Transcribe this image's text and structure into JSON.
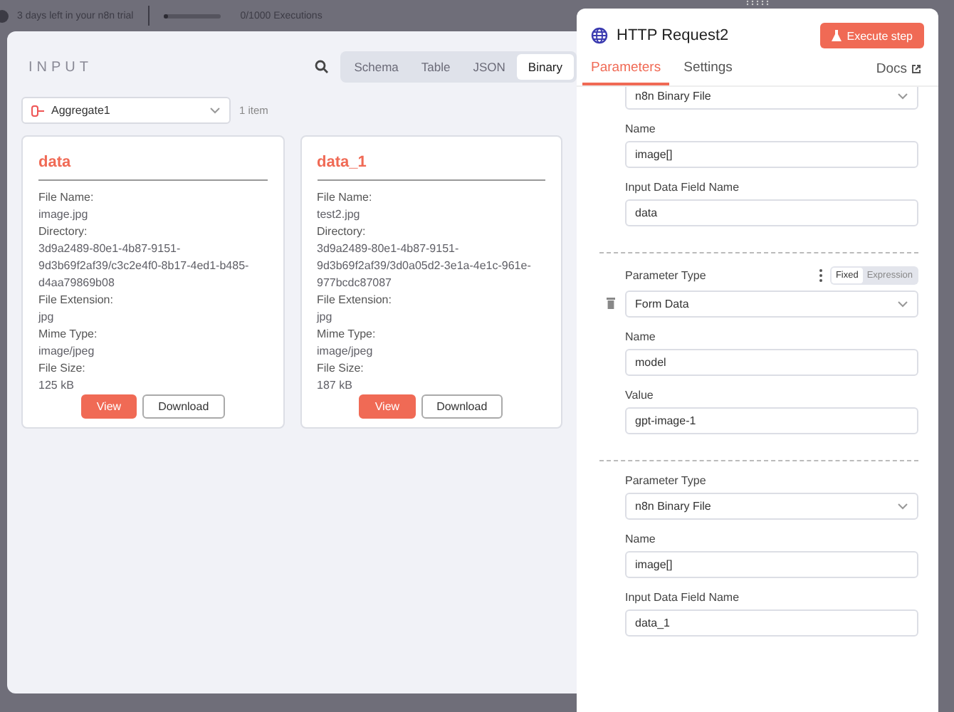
{
  "trial": {
    "text": "3 days left in your n8n trial",
    "executions": "0/1000 Executions",
    "level": 0.02
  },
  "input_panel": {
    "title": "INPUT",
    "view_tabs": [
      {
        "label": "Schema",
        "selected": false
      },
      {
        "label": "Table",
        "selected": false
      },
      {
        "label": "JSON",
        "selected": false
      },
      {
        "label": "Binary",
        "selected": true
      }
    ],
    "source": {
      "node": "Aggregate1",
      "count": "1 item"
    },
    "items": [
      {
        "title": "data",
        "fields": [
          {
            "label": "File Name:",
            "value": "image.jpg"
          },
          {
            "label": "Directory:",
            "value": "3d9a2489-80e1-4b87-9151-9d3b69f2af39/c3c2e4f0-8b17-4ed1-b485-d4aa79869b08"
          },
          {
            "label": "File Extension:",
            "value": "jpg"
          },
          {
            "label": "Mime Type:",
            "value": "image/jpeg"
          },
          {
            "label": "File Size:",
            "value": "125 kB"
          }
        ],
        "buttons": [
          {
            "label": "View",
            "primary": true
          },
          {
            "label": "Download",
            "primary": false
          }
        ]
      },
      {
        "title": "data_1",
        "fields": [
          {
            "label": "File Name:",
            "value": "test2.jpg"
          },
          {
            "label": "Directory:",
            "value": "3d9a2489-80e1-4b87-9151-9d3b69f2af39/3d0a05d2-3e1a-4e1c-961e-977bcdc87087"
          },
          {
            "label": "File Extension:",
            "value": "jpg"
          },
          {
            "label": "Mime Type:",
            "value": "image/jpeg"
          },
          {
            "label": "File Size:",
            "value": "187 kB"
          }
        ],
        "buttons": [
          {
            "label": "View",
            "primary": true
          },
          {
            "label": "Download",
            "primary": false
          }
        ]
      }
    ]
  },
  "node_panel": {
    "title": "HTTP Request2",
    "execute_button": "Execute step",
    "tabs": [
      {
        "label": "Parameters",
        "selected": true
      },
      {
        "label": "Settings",
        "selected": false
      }
    ],
    "docs": "Docs",
    "groups": [
      {
        "deletable": false,
        "rows": [
          {
            "kind": "select",
            "value": "n8n Binary File"
          },
          {
            "kind": "text",
            "label": "Name",
            "value": "image[]"
          },
          {
            "kind": "text",
            "label": "Input Data Field Name",
            "value": "data"
          }
        ]
      },
      {
        "deletable": true,
        "rows": [
          {
            "kind": "select",
            "label": "Parameter Type",
            "value": "Form Data",
            "modes": [
              {
                "label": "Fixed",
                "selected": true
              },
              {
                "label": "Expression",
                "selected": false
              }
            ]
          },
          {
            "kind": "text",
            "label": "Name",
            "value": "model"
          },
          {
            "kind": "text",
            "label": "Value",
            "value": "gpt-image-1"
          }
        ]
      },
      {
        "deletable": false,
        "rows": [
          {
            "kind": "select",
            "label": "Parameter Type",
            "value": "n8n Binary File"
          },
          {
            "kind": "text",
            "label": "Name",
            "value": "image[]"
          },
          {
            "kind": "text",
            "label": "Input Data Field Name",
            "value": "data_1"
          }
        ]
      }
    ]
  }
}
